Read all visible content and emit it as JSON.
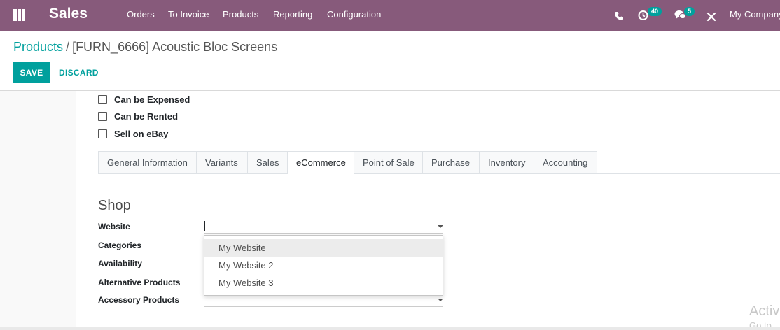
{
  "navbar": {
    "app_title": "Sales",
    "menu": [
      "Orders",
      "To Invoice",
      "Products",
      "Reporting",
      "Configuration"
    ],
    "activity_count": "40",
    "messages_count": "5",
    "company": "My Company"
  },
  "breadcrumb": {
    "parent": "Products",
    "separator": "/",
    "current": "[FURN_6666] Acoustic Bloc Screens"
  },
  "buttons": {
    "save": "SAVE",
    "discard": "DISCARD"
  },
  "checkboxes": [
    {
      "label": "Can be Expensed",
      "checked": false
    },
    {
      "label": "Can be Rented",
      "checked": false
    },
    {
      "label": "Sell on eBay",
      "checked": false
    }
  ],
  "tabs": [
    "General Information",
    "Variants",
    "Sales",
    "eCommerce",
    "Point of Sale",
    "Purchase",
    "Inventory",
    "Accounting"
  ],
  "active_tab": "eCommerce",
  "shop": {
    "title": "Shop",
    "fields": [
      "Website",
      "Categories",
      "Availability",
      "Alternative Products",
      "Accessory Products"
    ],
    "website_value": ""
  },
  "website_dropdown": {
    "options": [
      "My Website",
      "My Website 2",
      "My Website 3"
    ],
    "highlighted": "My Website"
  },
  "watermark": {
    "line1": "Activ",
    "line2": "Go to"
  },
  "colors": {
    "navbar": "#875a7b",
    "accent": "#00a09d"
  }
}
